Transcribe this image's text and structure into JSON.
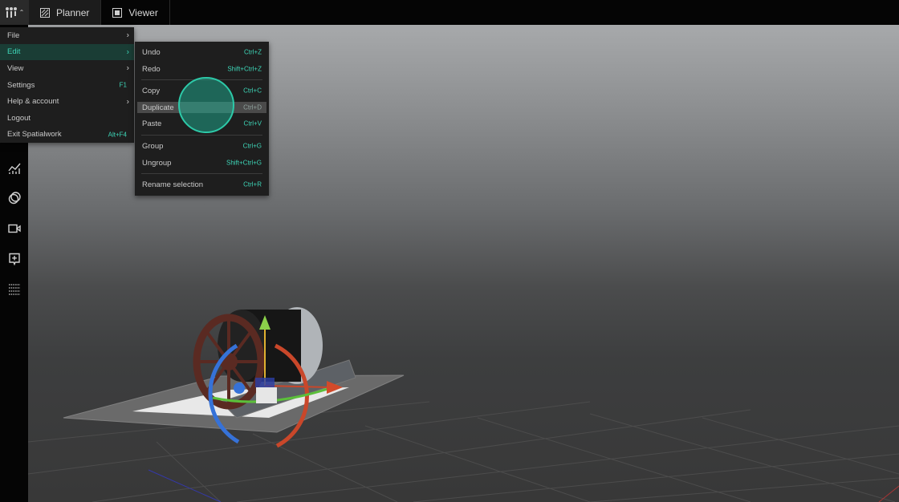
{
  "topbar": {
    "tabs": [
      {
        "label": "Planner",
        "icon": "planner-icon"
      },
      {
        "label": "Viewer",
        "icon": "viewer-icon"
      }
    ]
  },
  "main_menu": {
    "items": [
      {
        "label": "File",
        "has_submenu": true,
        "shortcut": ""
      },
      {
        "label": "Edit",
        "has_submenu": true,
        "shortcut": "",
        "active": true
      },
      {
        "label": "View",
        "has_submenu": true,
        "shortcut": ""
      },
      {
        "label": "Settings",
        "has_submenu": false,
        "shortcut": "F1"
      },
      {
        "label": "Help & account",
        "has_submenu": true,
        "shortcut": ""
      },
      {
        "label": "Logout",
        "has_submenu": false,
        "shortcut": ""
      },
      {
        "label": "Exit Spatialwork",
        "has_submenu": false,
        "shortcut": "Alt+F4"
      }
    ]
  },
  "edit_menu": {
    "items": [
      {
        "label": "Undo",
        "shortcut": "Ctrl+Z"
      },
      {
        "label": "Redo",
        "shortcut": "Shift+Ctrl+Z"
      },
      {
        "label": "Copy",
        "shortcut": "Ctrl+C"
      },
      {
        "label": "Duplicate",
        "shortcut": "Ctrl+D",
        "hover": true
      },
      {
        "label": "Paste",
        "shortcut": "Ctrl+V"
      },
      {
        "label": "Group",
        "shortcut": "Ctrl+G"
      },
      {
        "label": "Ungroup",
        "shortcut": "Shift+Ctrl+G"
      },
      {
        "label": "Rename selection",
        "shortcut": "Ctrl+R"
      }
    ]
  },
  "left_toolbar": {
    "tools": [
      "chart-icon",
      "layers-icon",
      "camera-icon",
      "add-annotation-icon",
      "grid-icon"
    ]
  },
  "colors": {
    "accent": "#3ed6b8",
    "menu_bg": "#1e1e1e",
    "topbar_bg": "#050505"
  }
}
